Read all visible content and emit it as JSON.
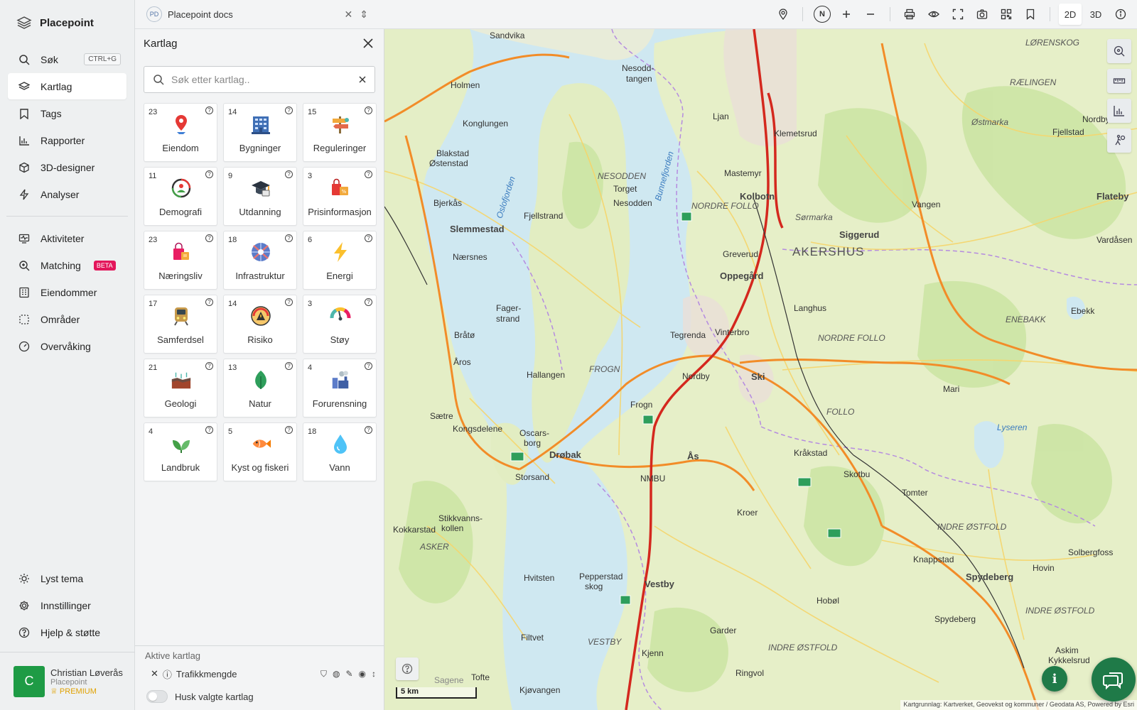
{
  "app": {
    "name": "Placepoint"
  },
  "sidebar": {
    "items": [
      {
        "label": "Søk",
        "icon": "search-icon",
        "shortcut": "CTRL+G"
      },
      {
        "label": "Kartlag",
        "icon": "layers-icon",
        "active": true
      },
      {
        "label": "Tags",
        "icon": "bookmark-icon"
      },
      {
        "label": "Rapporter",
        "icon": "bar-chart-icon"
      },
      {
        "label": "3D-designer",
        "icon": "cube-icon"
      },
      {
        "label": "Analyser",
        "icon": "bolt-icon"
      }
    ],
    "items2": [
      {
        "label": "Aktiviteter",
        "icon": "activity-icon"
      },
      {
        "label": "Matching",
        "icon": "matching-icon",
        "badge": "BETA"
      },
      {
        "label": "Eiendommer",
        "icon": "building-icon"
      },
      {
        "label": "Områder",
        "icon": "area-icon"
      },
      {
        "label": "Overvåking",
        "icon": "gauge-icon"
      }
    ],
    "bottom": [
      {
        "label": "Lyst tema",
        "icon": "sun-icon"
      },
      {
        "label": "Innstillinger",
        "icon": "gear-icon"
      },
      {
        "label": "Hjelp & støtte",
        "icon": "help-icon"
      }
    ],
    "user": {
      "initial": "C",
      "name": "Christian Løverås",
      "org": "Placepoint",
      "tier": "PREMIUM"
    }
  },
  "topbar": {
    "doc_badge": "PD",
    "doc_title": "Placepoint docs",
    "compass": "N",
    "view_2d": "2D",
    "view_3d": "3D",
    "active_view": "2D"
  },
  "panel": {
    "title": "Kartlag",
    "search_placeholder": "Søk etter kartlag..",
    "tiles": [
      {
        "count": "23",
        "label": "Eiendom",
        "icon": "map-pin-icon"
      },
      {
        "count": "14",
        "label": "Bygninger",
        "icon": "office-building-icon"
      },
      {
        "count": "15",
        "label": "Reguleringer",
        "icon": "signpost-icon"
      },
      {
        "count": "11",
        "label": "Demografi",
        "icon": "demography-icon"
      },
      {
        "count": "9",
        "label": "Utdanning",
        "icon": "graduation-cap-icon"
      },
      {
        "count": "3",
        "label": "Prisinformasjon",
        "icon": "price-bags-icon"
      },
      {
        "count": "23",
        "label": "Næringsliv",
        "icon": "shopping-bag-icon"
      },
      {
        "count": "18",
        "label": "Infrastruktur",
        "icon": "infrastructure-icon"
      },
      {
        "count": "6",
        "label": "Energi",
        "icon": "lightning-icon"
      },
      {
        "count": "17",
        "label": "Samferdsel",
        "icon": "train-icon"
      },
      {
        "count": "14",
        "label": "Risiko",
        "icon": "warning-gauge-icon"
      },
      {
        "count": "3",
        "label": "Støy",
        "icon": "noise-gauge-icon"
      },
      {
        "count": "21",
        "label": "Geologi",
        "icon": "soil-icon"
      },
      {
        "count": "13",
        "label": "Natur",
        "icon": "leaf-icon"
      },
      {
        "count": "4",
        "label": "Forurensning",
        "icon": "factory-icon"
      },
      {
        "count": "4",
        "label": "Landbruk",
        "icon": "sprout-icon"
      },
      {
        "count": "5",
        "label": "Kyst og fiskeri",
        "icon": "fish-icon"
      },
      {
        "count": "18",
        "label": "Vann",
        "icon": "water-drop-icon"
      }
    ],
    "active_title": "Aktive kartlag",
    "active_layers": [
      {
        "label": "Trafikkmengde"
      }
    ],
    "remember_label": "Husk valgte kartlag"
  },
  "map": {
    "labels": [
      "Sandvika",
      "Nesodd-",
      "tangen",
      "LØRENSKOG",
      "RÆLINGEN",
      "Østmarka",
      "Nordby bruk",
      "Fjellstad",
      "Holmen",
      "Konglungen",
      "Blakstad",
      "Østenstad",
      "NESODDEN",
      "Torget",
      "Nesodden",
      "Ljan",
      "Klemetsrud",
      "Mastemyr",
      "Kolbotn",
      "NORDRE FOLLO",
      "Sørmarka",
      "Siggerud",
      "AKERSHUS",
      "Vangen",
      "Flateby",
      "Vardåsen",
      "Fjellstrand",
      "Slemmestad",
      "Bjerkås",
      "Nærsnes",
      "Greverud",
      "Oppegård",
      "Langhus",
      "ENEBAKK",
      "Ebekk",
      "Fager-",
      "strand",
      "Bråtø",
      "Tegrenda",
      "Vinterbro",
      "NORDRE FOLLO",
      "Åros",
      "Hallangen",
      "FROGN",
      "Nordby",
      "Ski",
      "Mari",
      "Frogn",
      "FOLLO",
      "Sætre",
      "Kongsdelene",
      "Oscars-",
      "borg",
      "Drøbak",
      "Ås",
      "Kråkstad",
      "Skotbu",
      "Lyseren",
      "Storsand",
      "NMBU",
      "Tomter",
      "Stikkvanns-",
      "kollen",
      "Kokkarstad",
      "ASKER",
      "INDRE ØSTFOLD",
      "Knappstad",
      "Hovin",
      "Solbergfoss",
      "Kroer",
      "Hvitsten",
      "Pepperstad",
      "skog",
      "Vestby",
      "Hobøl",
      "Spydeberg",
      "Spydeberg",
      "INDRE ØSTFOLD",
      "Garder",
      "Filtvet",
      "VESTBY",
      "Kjenn",
      "INDRE ØSTFOLD",
      "Ringvol",
      "Tofte",
      "Kjøvangen",
      "Askim",
      "Kykkelsrud",
      "Oslofjorden",
      "Bunnefjorden",
      "Sagene"
    ],
    "scale_label": "5 km",
    "attribution": "Kartgrunnlag: Kartverket, Geovekst og kommuner / Geodata AS, Powered by Esri",
    "info_label": "i"
  },
  "colors": {
    "accent_green": "#1e9b45",
    "beta_badge": "#e3165b",
    "premium": "#e0a100",
    "water": "#cfe8f1",
    "land": "#e6efc8"
  }
}
